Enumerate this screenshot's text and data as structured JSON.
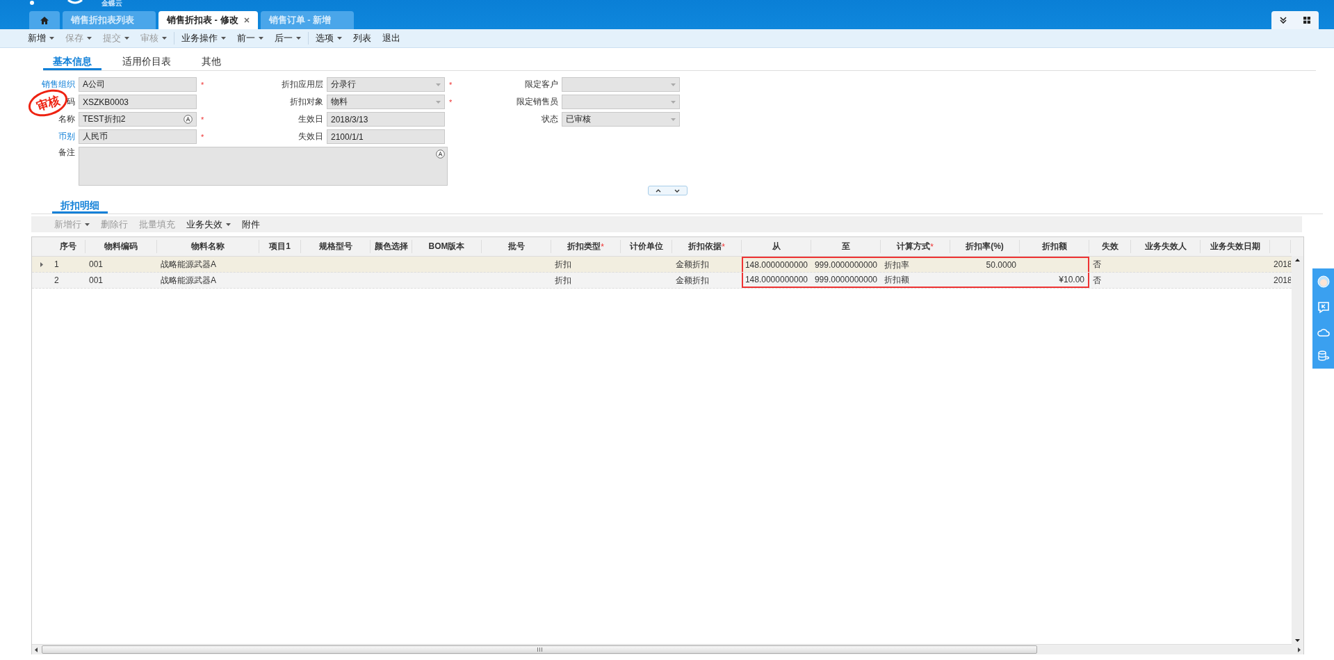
{
  "header": {
    "logo_text": "金蝶云",
    "tabs": [
      {
        "kind": "home",
        "selected": false
      },
      {
        "label": "销售折扣表列表",
        "selected": false,
        "closable": false
      },
      {
        "label": "销售折扣表 - 修改",
        "selected": true,
        "closable": true
      },
      {
        "label": "销售订单 - 新增",
        "selected": false,
        "closable": false
      }
    ]
  },
  "toolbar": [
    {
      "label": "新增",
      "menu": true,
      "disabled": false,
      "separator_after": false
    },
    {
      "label": "保存",
      "menu": true,
      "disabled": true,
      "separator_after": false
    },
    {
      "label": "提交",
      "menu": true,
      "disabled": true,
      "separator_after": false
    },
    {
      "label": "审核",
      "menu": true,
      "disabled": true,
      "separator_after": true
    },
    {
      "label": "业务操作",
      "menu": true,
      "disabled": false,
      "separator_after": false
    },
    {
      "label": "前一",
      "menu": true,
      "disabled": false,
      "separator_after": false
    },
    {
      "label": "后一",
      "menu": true,
      "disabled": false,
      "separator_after": true
    },
    {
      "label": "选项",
      "menu": true,
      "disabled": false,
      "separator_after": false
    },
    {
      "label": "列表",
      "menu": false,
      "disabled": false,
      "separator_after": false
    },
    {
      "label": "退出",
      "menu": false,
      "disabled": false,
      "separator_after": false
    }
  ],
  "form_tabs": [
    {
      "label": "基本信息",
      "selected": true
    },
    {
      "label": "适用价目表",
      "selected": false
    },
    {
      "label": "其他",
      "selected": false
    }
  ],
  "stamp": "审核",
  "required_mark": "*",
  "form_columns": [
    [
      {
        "label": "销售组织",
        "link": true,
        "kind": "text",
        "value": "A公司",
        "required": true,
        "multilang": false
      },
      {
        "label": "码",
        "link": false,
        "kind": "text",
        "value": "XSZKB0003",
        "required": false,
        "multilang": false,
        "stamped": true
      },
      {
        "label": "名称",
        "link": false,
        "kind": "text",
        "value": "TEST折扣2",
        "required": true,
        "multilang": true
      },
      {
        "label": "币别",
        "link": true,
        "kind": "text",
        "value": "人民币",
        "required": true,
        "multilang": false
      }
    ],
    [
      {
        "label": "折扣应用层",
        "link": false,
        "kind": "select",
        "value": "分录行",
        "required": true
      },
      {
        "label": "折扣对象",
        "link": false,
        "kind": "select",
        "value": "物料",
        "required": true
      },
      {
        "label": "生效日",
        "link": false,
        "kind": "text",
        "value": "2018/3/13",
        "required": false,
        "multilang": false
      },
      {
        "label": "失效日",
        "link": false,
        "kind": "text",
        "value": "2100/1/1",
        "required": false,
        "multilang": false
      }
    ],
    [
      {
        "label": "限定客户",
        "link": false,
        "kind": "select",
        "required": false
      },
      {
        "label": "限定销售员",
        "link": false,
        "kind": "select",
        "required": false
      },
      {
        "label": "状态",
        "link": false,
        "kind": "select",
        "value": "已审核",
        "required": false
      }
    ]
  ],
  "remark": {
    "label": "备注"
  },
  "detail": {
    "tab": "折扣明细",
    "toolbar": [
      {
        "label": "新增行",
        "menu": true,
        "disabled": true
      },
      {
        "label": "删除行",
        "menu": false,
        "disabled": true
      },
      {
        "label": "批量填充",
        "menu": false,
        "disabled": true
      },
      {
        "label": "业务失效",
        "menu": true,
        "disabled": false
      },
      {
        "label": "附件",
        "menu": false,
        "disabled": false
      }
    ],
    "columns": [
      {
        "label": "序号",
        "required": false
      },
      {
        "label": "物料编码",
        "required": false
      },
      {
        "label": "物料名称",
        "required": false
      },
      {
        "label": "项目1",
        "required": false
      },
      {
        "label": "规格型号",
        "required": false
      },
      {
        "label": "颜色选择",
        "required": false
      },
      {
        "label": "BOM版本",
        "required": false
      },
      {
        "label": "批号",
        "required": false
      },
      {
        "label": "折扣类型",
        "required": true
      },
      {
        "label": "计价单位",
        "required": false
      },
      {
        "label": "折扣依据",
        "required": true
      },
      {
        "label": "从",
        "required": false
      },
      {
        "label": "至",
        "required": false
      },
      {
        "label": "计算方式",
        "required": true
      },
      {
        "label": "折扣率(%)",
        "required": false
      },
      {
        "label": "折扣额",
        "required": false
      },
      {
        "label": "失效",
        "required": false
      },
      {
        "label": "业务失效人",
        "required": false
      },
      {
        "label": "业务失效日期",
        "required": false
      }
    ],
    "rows": [
      {
        "selected": true,
        "seq": "1",
        "material_code": "001",
        "material_name": "战略能源武器A",
        "discount_type": "折扣",
        "discount_basis": "金额折扣",
        "from": "148.0000000000",
        "to": "999.0000000000",
        "calc_method": "折扣率",
        "discount_rate": "50.0000",
        "expired": "否",
        "column_21": "2018"
      },
      {
        "selected": false,
        "seq": "2",
        "material_code": "001",
        "material_name": "战略能源武器A",
        "discount_type": "折扣",
        "discount_basis": "金额折扣",
        "from": "148.0000000000",
        "to": "999.0000000000",
        "calc_method": "折扣额",
        "discount_amount": "¥10.00",
        "expired": "否",
        "column_21": "2018"
      }
    ]
  }
}
